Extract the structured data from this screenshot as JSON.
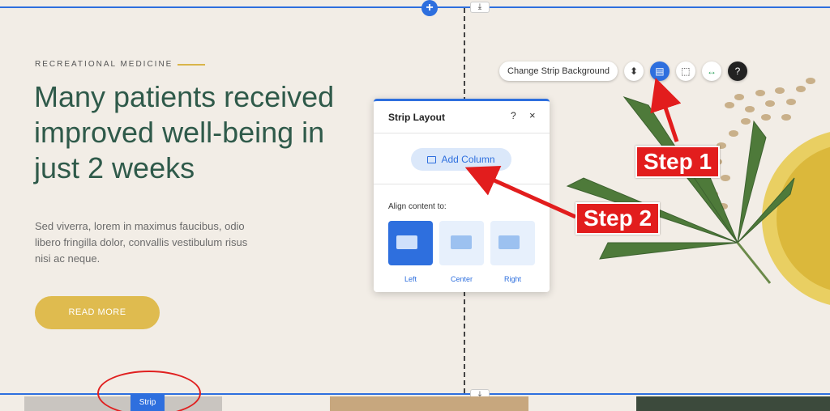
{
  "editor": {
    "add_section_icon": "+",
    "snap_icon": "⤓"
  },
  "hero": {
    "eyebrow": "RECREATIONAL MEDICINE",
    "headline": "Many patients received improved well-being in just 2 weeks",
    "body": "Sed viverra, lorem in maximus faucibus, odio libero fringilla dolor, convallis vestibulum risus nisi ac neque.",
    "cta": "READ MORE"
  },
  "toolbar": {
    "change_bg": "Change Strip Background",
    "icons": [
      "animation-icon",
      "layout-icon",
      "crop-icon",
      "stretch-icon",
      "help-icon"
    ]
  },
  "panel": {
    "title": "Strip Layout",
    "help": "?",
    "close": "×",
    "add_column": "Add Column",
    "align_label": "Align content to:",
    "options": [
      "Left",
      "Center",
      "Right"
    ],
    "selected": "Left"
  },
  "strip_tag": "Strip",
  "annotations": {
    "step1": "Step 1",
    "step2": "Step 2"
  },
  "colors": {
    "accent": "#2e6fde",
    "headline": "#2f5a4a",
    "cta": "#dfbb4f",
    "annotation": "#e21d1d",
    "background": "#f2ede6"
  }
}
